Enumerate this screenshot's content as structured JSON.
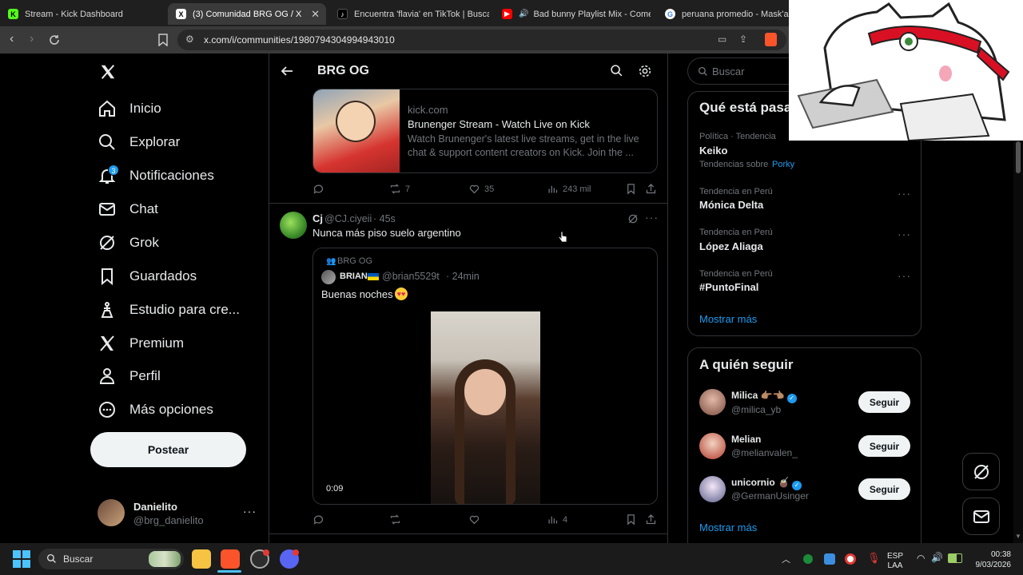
{
  "browser": {
    "tabs": [
      {
        "label": "Stream - Kick Dashboard",
        "favicon": "K",
        "color": "#53fc18"
      },
      {
        "label": "(3) Comunidad BRG OG / X",
        "favicon": "X",
        "color": "#ffffff"
      },
      {
        "label": "Encuentra 'flavia' en TikTok | Busca co",
        "favicon": "t",
        "color": "#000000"
      },
      {
        "label": "Bad bunny Playlist Mix - Come Ri",
        "favicon": "▶",
        "color": "#ff0000"
      },
      {
        "label": "peruana promedio - Mask'ana",
        "favicon": "G",
        "color": "#ffffff"
      }
    ],
    "url": "x.com/i/communities/1980794304994943010"
  },
  "sidebar": {
    "items": [
      {
        "label": "Inicio",
        "icon": "home-icon"
      },
      {
        "label": "Explorar",
        "icon": "search-icon"
      },
      {
        "label": "Notificaciones",
        "icon": "bell-icon",
        "badge": "3"
      },
      {
        "label": "Chat",
        "icon": "mail-icon"
      },
      {
        "label": "Grok",
        "icon": "grok-icon"
      },
      {
        "label": "Guardados",
        "icon": "bookmark-icon"
      },
      {
        "label": "Estudio para cre...",
        "icon": "creator-studio-icon"
      },
      {
        "label": "Premium",
        "icon": "x-logo-icon"
      },
      {
        "label": "Perfil",
        "icon": "person-icon"
      },
      {
        "label": "Más opciones",
        "icon": "more-circle-icon"
      }
    ],
    "post_button": "Postear",
    "account": {
      "name": "Danielito",
      "handle": "@brg_danielito"
    }
  },
  "header": {
    "title": "BRG OG"
  },
  "link_card": {
    "domain": "kick.com",
    "title": "Brunenger Stream - Watch Live on Kick",
    "description": "Watch Brunenger's latest live streams, get in the live chat & support content creators on Kick. Join the ..."
  },
  "post1_actions": {
    "reposts": "7",
    "likes": "35",
    "views": "243 mil"
  },
  "post2": {
    "name": "Cj",
    "handle": "@CJ.ciyeii",
    "time": "· 45s",
    "text": "Nunca más piso suelo argentino",
    "quote": {
      "community": "BRG OG",
      "name": "BRIAN",
      "handle": "@brian5529t",
      "time": "· 24min",
      "text": "Buenas noches",
      "video_time": "0:09"
    },
    "views": "4"
  },
  "right": {
    "search_placeholder": "Buscar",
    "trends_title": "Qué está pasa",
    "trends": [
      {
        "meta": "Política · Tendencia",
        "name": "Keiko",
        "extra_prefix": "Tendencias sobre",
        "extra_link": "Porky"
      },
      {
        "meta": "Tendencia en Perú",
        "name": "Mónica Delta"
      },
      {
        "meta": "Tendencia en Perú",
        "name": "López Aliaga"
      },
      {
        "meta": "Tendencia en Perú",
        "name": "#PuntoFinal"
      }
    ],
    "show_more": "Mostrar más",
    "follow_title": "A quién seguir",
    "follow": [
      {
        "name": "Milica",
        "handle": "@milica_yb",
        "button": "Seguir"
      },
      {
        "name": "Melian",
        "handle": "@melianvalen_",
        "button": "Seguir"
      },
      {
        "name": "unicornio",
        "handle": "@GermanUsinger",
        "button": "Seguir"
      }
    ],
    "follow_more": "Mostrar más"
  },
  "taskbar": {
    "search": "Buscar",
    "lang1": "ESP",
    "lang2": "LAA",
    "time": "00:38",
    "date": "9/03/2026"
  },
  "colors": {
    "accent": "#1d9bf0",
    "border": "#2f3336",
    "muted": "#71767b"
  }
}
